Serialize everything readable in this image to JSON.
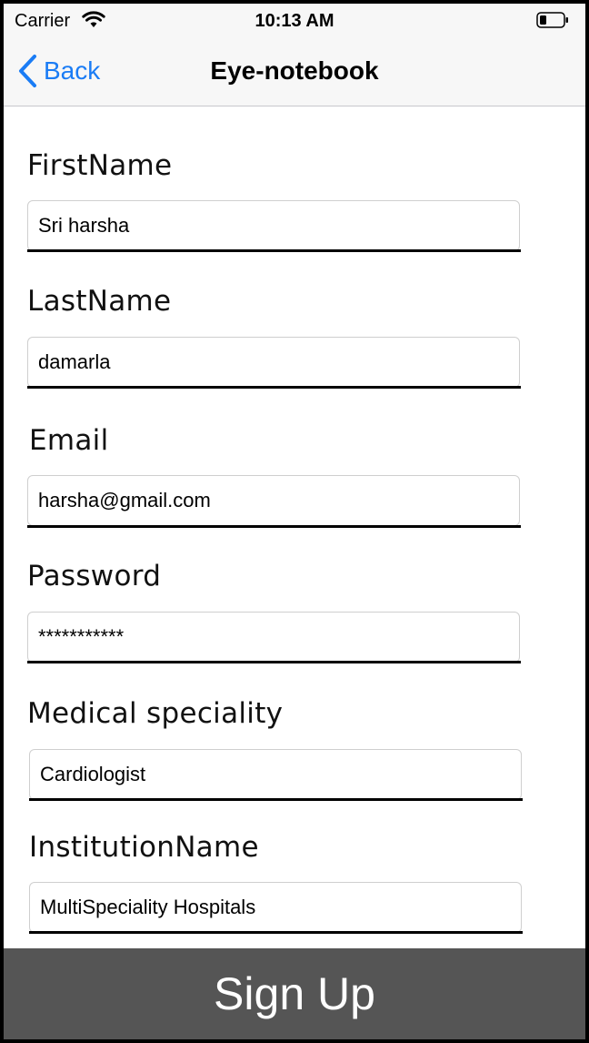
{
  "status_bar": {
    "carrier": "Carrier",
    "time": "10:13 AM"
  },
  "nav": {
    "back_label": "Back",
    "title": "Eye-notebook"
  },
  "form": {
    "first_name": {
      "label": "FirstName",
      "value": "Sri harsha"
    },
    "last_name": {
      "label": "LastName",
      "value": "damarla"
    },
    "email": {
      "label": "Email",
      "value": "harsha@gmail.com"
    },
    "password": {
      "label": "Password",
      "value": "***********"
    },
    "speciality": {
      "label": "Medical speciality",
      "value": "Cardiologist"
    },
    "institution": {
      "label": "InstitutionName",
      "value": "MultiSpeciality Hospitals"
    }
  },
  "signup_label": "Sign Up",
  "colors": {
    "accent": "#1a7cf5",
    "button_bg": "#555555"
  }
}
